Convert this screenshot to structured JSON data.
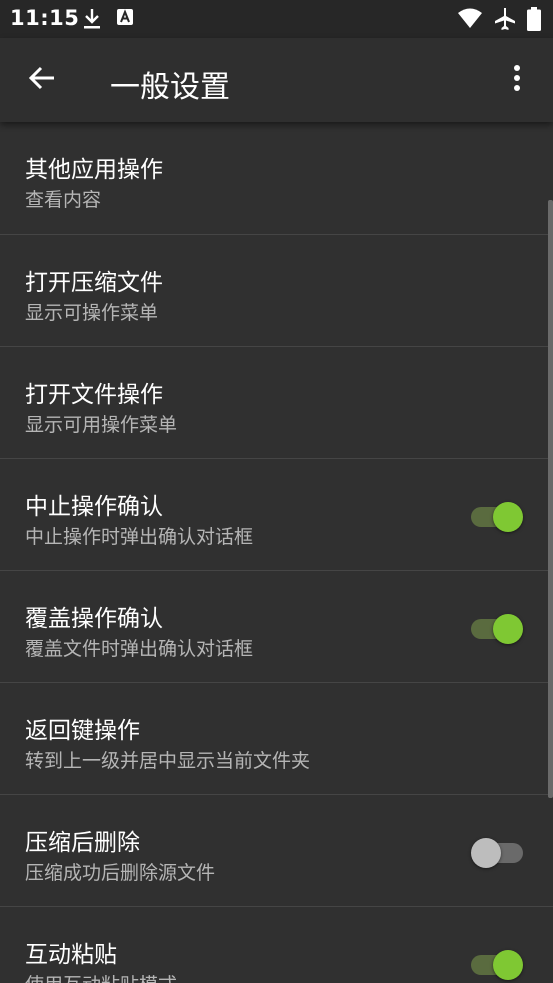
{
  "status_bar": {
    "time": "11:15",
    "left_icons": [
      "download-icon",
      "font-app-icon"
    ],
    "right_icons": [
      "wifi-icon",
      "airplane-icon",
      "battery-icon"
    ]
  },
  "app_bar": {
    "title": "一般设置",
    "back_icon": "arrow-back-icon",
    "more_icon": "more-vert-icon"
  },
  "colors": {
    "background": "#303030",
    "app_bar": "#2f2f2f",
    "accent": "#7fc833",
    "track_on": "#5a6b3f",
    "subtitle": "#b5b5b5"
  },
  "settings": [
    {
      "title": "其他应用操作",
      "subtitle": "查看内容"
    },
    {
      "title": "打开压缩文件",
      "subtitle": "显示可操作菜单"
    },
    {
      "title": "打开文件操作",
      "subtitle": "显示可用操作菜单"
    },
    {
      "title": "中止操作确认",
      "subtitle": "中止操作时弹出确认对话框",
      "toggle": true
    },
    {
      "title": "覆盖操作确认",
      "subtitle": "覆盖文件时弹出确认对话框",
      "toggle": true
    },
    {
      "title": "返回键操作",
      "subtitle": "转到上一级并居中显示当前文件夹"
    },
    {
      "title": "压缩后删除",
      "subtitle": "压缩成功后删除源文件",
      "toggle": false
    },
    {
      "title": "互动粘贴",
      "subtitle": "使用互动粘贴模式",
      "toggle": true
    }
  ]
}
